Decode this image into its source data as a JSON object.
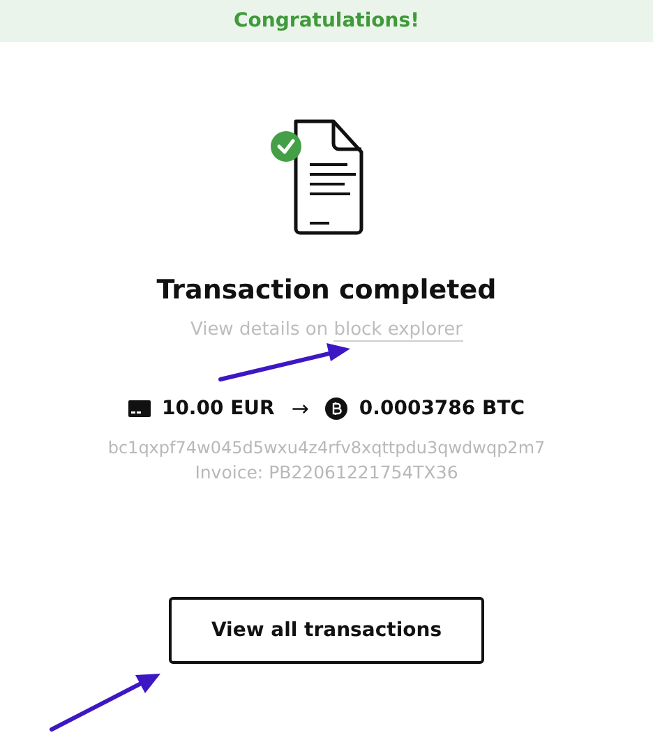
{
  "banner": {
    "text": "Congratulations!"
  },
  "status": {
    "title": "Transaction completed",
    "details_prefix": "View details on ",
    "details_link": "block explorer"
  },
  "exchange": {
    "from_amount": "10.00 EUR",
    "arrow": "→",
    "to_amount": "0.0003786 BTC"
  },
  "address": "bc1qxpf74w045d5wxu4z4rfv8xqttpdu3qwdwqp2m7",
  "invoice": "Invoice: PB22061221754TX36",
  "button": "View all transactions"
}
